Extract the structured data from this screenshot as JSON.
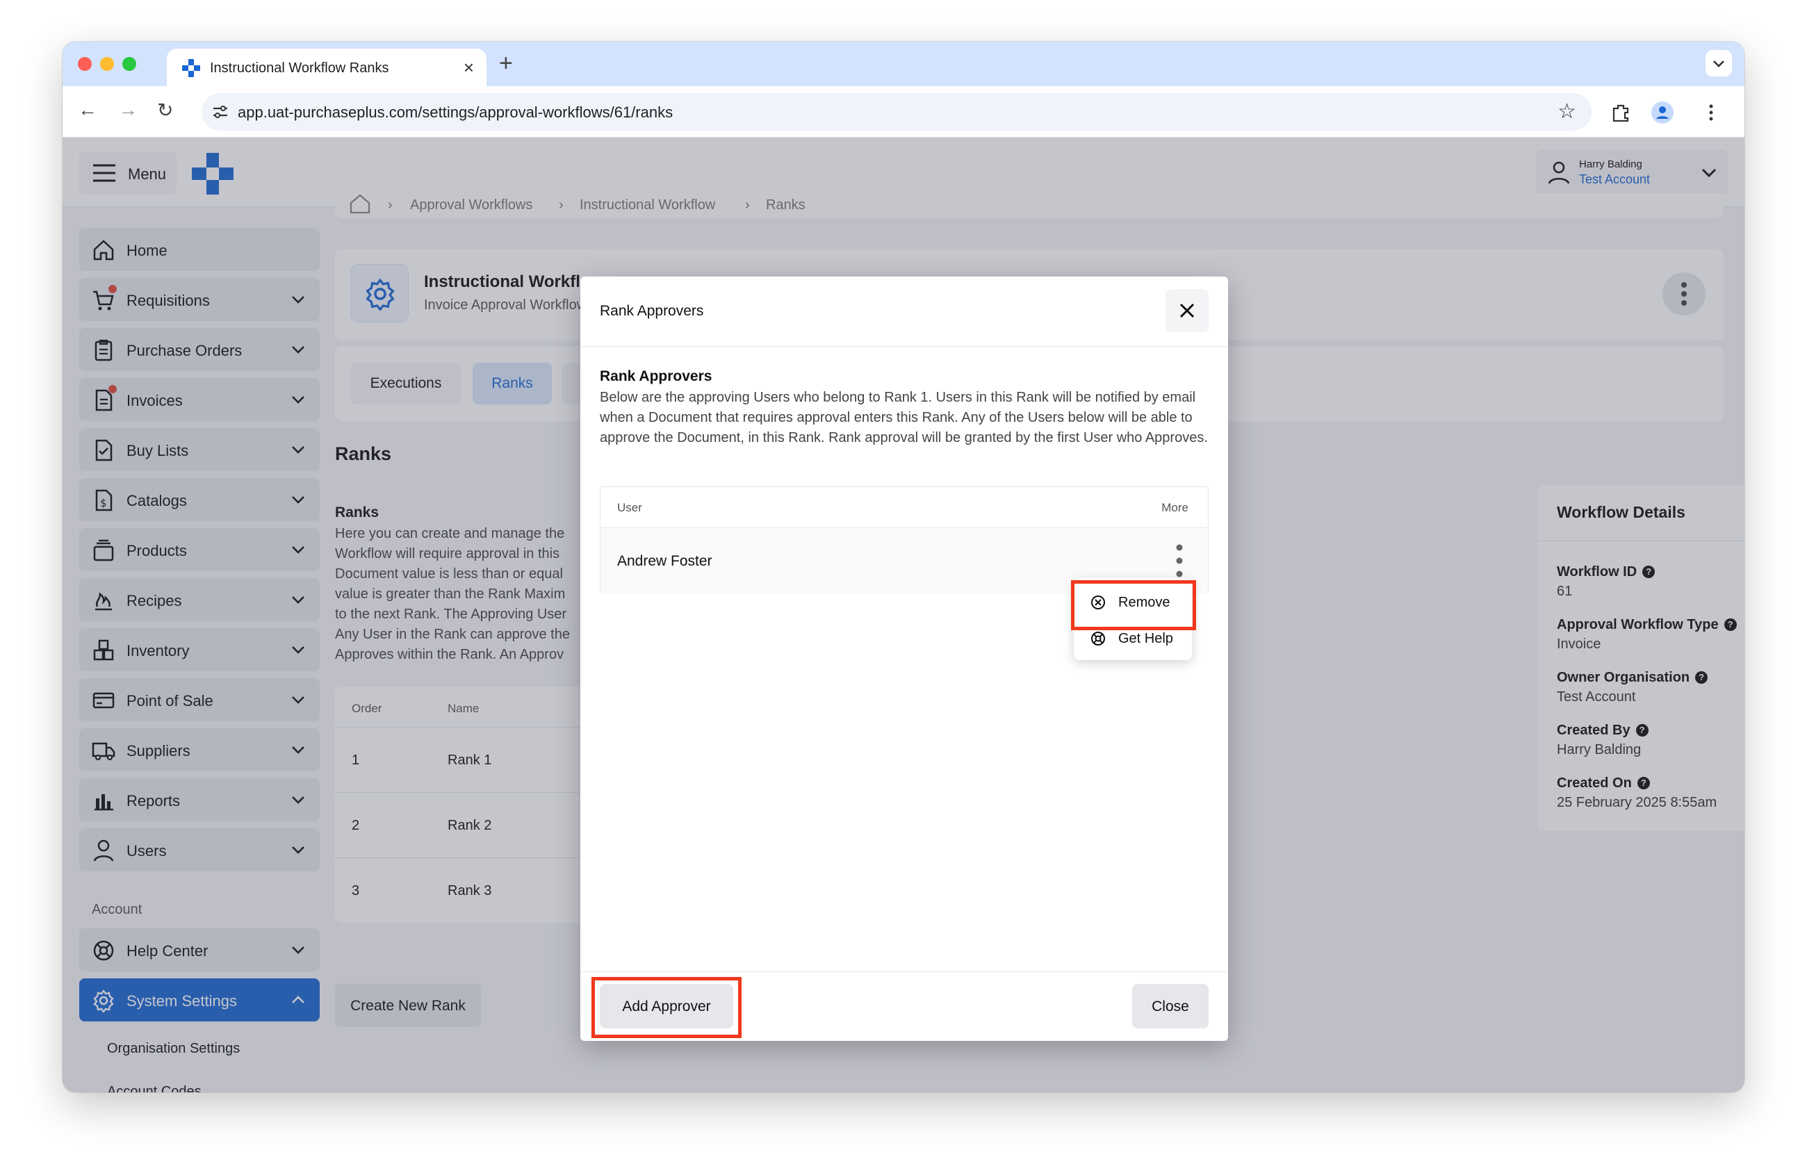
{
  "browser": {
    "tab_title": "Instructional Workflow Ranks",
    "url": "app.uat-purchaseplus.com/settings/approval-workflows/61/ranks"
  },
  "topbar": {
    "menu_label": "Menu",
    "user_name": "Harry Balding",
    "user_account": "Test Account"
  },
  "sidebar": {
    "items": [
      {
        "label": "Home",
        "icon": "home-icon"
      },
      {
        "label": "Requisitions",
        "icon": "cart-icon"
      },
      {
        "label": "Purchase Orders",
        "icon": "clipboard-icon"
      },
      {
        "label": "Invoices",
        "icon": "invoice-icon"
      },
      {
        "label": "Buy Lists",
        "icon": "checklist-icon"
      },
      {
        "label": "Catalogs",
        "icon": "dollar-doc-icon"
      },
      {
        "label": "Products",
        "icon": "box-icon"
      },
      {
        "label": "Recipes",
        "icon": "flame-icon"
      },
      {
        "label": "Inventory",
        "icon": "boxes-icon"
      },
      {
        "label": "Point of Sale",
        "icon": "card-icon"
      },
      {
        "label": "Suppliers",
        "icon": "truck-icon"
      },
      {
        "label": "Reports",
        "icon": "bar-chart-icon"
      },
      {
        "label": "Users",
        "icon": "user-icon"
      }
    ],
    "account_heading": "Account",
    "help_center": "Help Center",
    "system_settings": "System Settings",
    "sub_items": [
      "Organisation Settings",
      "Account Codes"
    ]
  },
  "breadcrumbs": [
    "Approval Workflows",
    "Instructional Workflow",
    "Ranks"
  ],
  "header": {
    "title": "Instructional Workflow",
    "subtitle": "Invoice Approval Workflow"
  },
  "tabs": [
    "Executions",
    "Ranks"
  ],
  "ranks": {
    "title": "Ranks",
    "subheading": "Ranks",
    "description_lines": [
      "Here you can create and manage the",
      "Workflow will require approval in this",
      "Document value is less than or equal",
      "value is greater than the Rank Maxim",
      "to the next Rank. The Approving User",
      "Any User in the Rank can approve the",
      "Approves within the Rank. An Approv"
    ],
    "col_order": "Order",
    "col_name": "Name",
    "rows": [
      {
        "order": "1",
        "name": "Rank 1"
      },
      {
        "order": "2",
        "name": "Rank 2"
      },
      {
        "order": "3",
        "name": "Rank 3"
      }
    ],
    "create_button": "Create New Rank"
  },
  "details": {
    "heading": "Workflow Details",
    "fields": [
      {
        "label": "Workflow ID",
        "value": "61"
      },
      {
        "label": "Approval Workflow Type",
        "value": "Invoice"
      },
      {
        "label": "Owner Organisation",
        "value": "Test Account"
      },
      {
        "label": "Created By",
        "value": "Harry Balding"
      },
      {
        "label": "Created On",
        "value": "25 February 2025 8:55am"
      }
    ]
  },
  "modal": {
    "title": "Rank Approvers",
    "heading": "Rank Approvers",
    "description": "Below are the approving Users who belong to Rank 1. Users in this Rank will be notified by email when a Document that requires approval enters this Rank. Any of the Users below will be able to approve the Document, in this Rank. Rank approval will be granted by the first User who Approves.",
    "col_user": "User",
    "col_more": "More",
    "approver": "Andrew Foster",
    "menu_remove": "Remove",
    "menu_help": "Get Help",
    "add_button": "Add Approver",
    "close_button": "Close"
  },
  "colors": {
    "accent": "#1a66d2",
    "highlight": "#f0381c"
  }
}
